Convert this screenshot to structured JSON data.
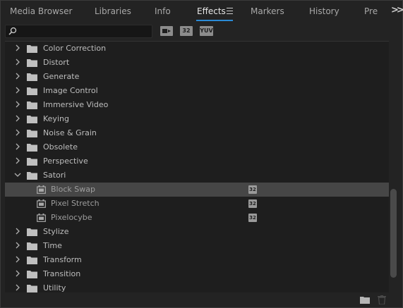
{
  "tabs": [
    {
      "label": "Media Browser"
    },
    {
      "label": "Libraries"
    },
    {
      "label": "Info"
    },
    {
      "label": "Effects"
    },
    {
      "label": "Markers"
    },
    {
      "label": "History"
    },
    {
      "label": "Pre"
    }
  ],
  "active_tab": "Effects",
  "search": {
    "value": "",
    "placeholder": ""
  },
  "filters": [
    {
      "label": "",
      "icon": "accelerated-effects-icon"
    },
    {
      "label": "32",
      "icon": "32-bit-effects-icon"
    },
    {
      "label": "YUV",
      "icon": "yuv-effects-icon"
    }
  ],
  "list": [
    {
      "type": "folder",
      "label": "Color Correction",
      "expanded": false
    },
    {
      "type": "folder",
      "label": "Distort",
      "expanded": false
    },
    {
      "type": "folder",
      "label": "Generate",
      "expanded": false
    },
    {
      "type": "folder",
      "label": "Image Control",
      "expanded": false
    },
    {
      "type": "folder",
      "label": "Immersive Video",
      "expanded": false
    },
    {
      "type": "folder",
      "label": "Keying",
      "expanded": false
    },
    {
      "type": "folder",
      "label": "Noise & Grain",
      "expanded": false
    },
    {
      "type": "folder",
      "label": "Obsolete",
      "expanded": false
    },
    {
      "type": "folder",
      "label": "Perspective",
      "expanded": false
    },
    {
      "type": "folder",
      "label": "Satori",
      "expanded": true
    },
    {
      "type": "effect",
      "label": "Block Swap",
      "badge": "32",
      "selected": true
    },
    {
      "type": "effect",
      "label": "Pixel Stretch",
      "badge": "32"
    },
    {
      "type": "effect",
      "label": "Pixelocybe",
      "badge": "32"
    },
    {
      "type": "folder",
      "label": "Stylize",
      "expanded": false
    },
    {
      "type": "folder",
      "label": "Time",
      "expanded": false
    },
    {
      "type": "folder",
      "label": "Transform",
      "expanded": false
    },
    {
      "type": "folder",
      "label": "Transition",
      "expanded": false
    },
    {
      "type": "folder",
      "label": "Utility",
      "expanded": false
    }
  ],
  "colors": {
    "accent": "#2b8bd6",
    "selected_row": "#464646"
  },
  "bottom_icons": [
    "new-bin-icon",
    "trash-icon"
  ]
}
